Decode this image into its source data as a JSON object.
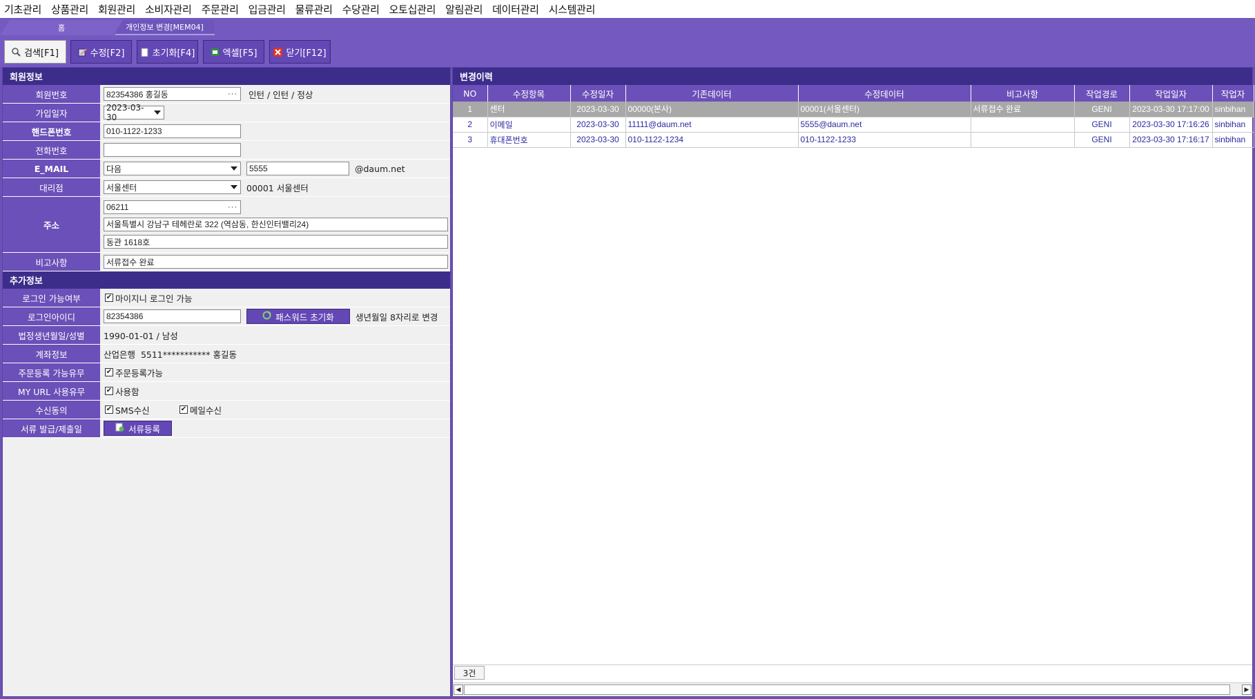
{
  "menu": [
    "기초관리",
    "상품관리",
    "회원관리",
    "소비자관리",
    "주문관리",
    "입금관리",
    "물류관리",
    "수당관리",
    "오토십관리",
    "알림관리",
    "데이터관리",
    "시스템관리"
  ],
  "tabs": {
    "home": "홈",
    "active": "개인정보 변경[MEM04]"
  },
  "toolbar": {
    "search": "검색[F1]",
    "edit": "수정[F2]",
    "reset": "초기화[F4]",
    "excel": "엑셀[F5]",
    "close": "닫기[F12]"
  },
  "member": {
    "section_title": "회원정보",
    "labels": {
      "member_no": "회원번호",
      "join_date": "가입일자",
      "mobile": "핸드폰번호",
      "phone": "전화번호",
      "email": "E_MAIL",
      "agency": "대리점",
      "address": "주소",
      "remarks": "비고사항"
    },
    "member_no": "82354386 홍길동",
    "member_status": "인턴 / 인턴 / 정상",
    "join_date": "2023-03-30",
    "mobile": "010-1122-1233",
    "phone": "",
    "email_domain_select": "다음",
    "email_id": "5555",
    "email_suffix": "@daum.net",
    "agency_select": "서울센터",
    "agency_code": "00001 서울센터",
    "zip": "06211",
    "address1": "서울특별시 강남구 테헤란로 322 (역삼동, 한신인터밸리24)",
    "address2": "동관 1618호",
    "remarks": "서류접수 완료"
  },
  "extra": {
    "section_title": "추가정보",
    "labels": {
      "login_allowed": "로그인 가능여부",
      "login_id": "로그인아이디",
      "birth_gender": "법정생년월일/성별",
      "account": "계좌정보",
      "order_reg": "주문등록 가능유무",
      "my_url": "MY URL 사용유무",
      "consent": "수신동의",
      "docs": "서류 발급/제출일"
    },
    "login_allowed_text": "마이지니 로그인 가능",
    "login_id": "82354386",
    "pw_reset_button": "패스워드 초기화",
    "pw_reset_note": "생년월일 8자리로 변경",
    "birth_gender": "1990-01-01 / 남성",
    "account": "산업은행  5511*********** 홍길동",
    "order_reg_text": "주문등록가능",
    "my_url_text": "사용함",
    "sms_text": "SMS수신",
    "mail_text": "메일수신",
    "docs_button": "서류등록"
  },
  "history": {
    "section_title": "변경이력",
    "columns": [
      "NO",
      "수정항목",
      "수정일자",
      "기존데이터",
      "수정데이터",
      "비고사항",
      "작업경로",
      "작업일자",
      "작업자"
    ],
    "rows": [
      [
        "1",
        "센터",
        "2023-03-30",
        "00000(본사)",
        "00001(서울센터)",
        "서류접수 완료",
        "GENI",
        "2023-03-30 17:17:00",
        "sinbihan"
      ],
      [
        "2",
        "이메일",
        "2023-03-30",
        "11111@daum.net",
        "5555@daum.net",
        "",
        "GENI",
        "2023-03-30 17:16:26",
        "sinbihan"
      ],
      [
        "3",
        "휴대폰번호",
        "2023-03-30",
        "010-1122-1234",
        "010-1122-1233",
        "",
        "GENI",
        "2023-03-30 17:16:17",
        "sinbihan"
      ]
    ],
    "count": "3건"
  }
}
